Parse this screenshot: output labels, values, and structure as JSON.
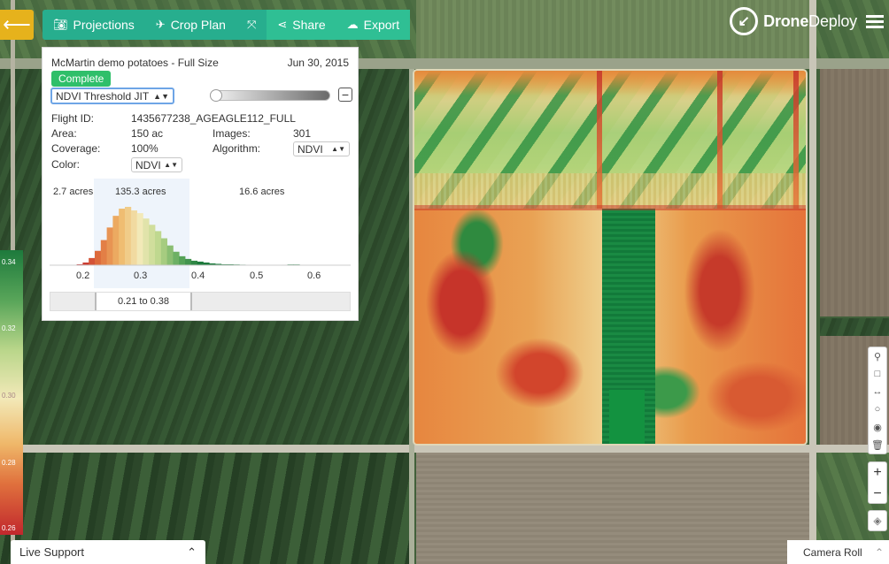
{
  "toolbar": {
    "back_icon": "arrow-left-icon",
    "projections": "Projections",
    "crop_plan": "Crop Plan",
    "share": "Share",
    "export": "Export"
  },
  "brand": {
    "name_bold": "Drone",
    "name_rest": "Deploy"
  },
  "panel": {
    "title": "McMartin demo potatoes - Full Size",
    "date": "Jun 30, 2015",
    "status": "Complete",
    "layer_select": "NDVI Threshold JIT",
    "flight_id_label": "Flight ID:",
    "flight_id": "1435677238_AGEAGLE112_FULL",
    "area_label": "Area:",
    "area": "150 ac",
    "images_label": "Images:",
    "images": "301",
    "coverage_label": "Coverage:",
    "coverage": "100%",
    "algorithm_label": "Algorithm:",
    "algorithm": "NDVI",
    "color_label": "Color:",
    "color": "NDVI",
    "range_text": "0.21 to 0.38"
  },
  "chart_data": {
    "type": "bar",
    "x_ticks": [
      "0.2",
      "0.3",
      "0.4",
      "0.5",
      "0.6"
    ],
    "xlim": [
      0.15,
      0.65
    ],
    "selection": [
      0.21,
      0.38
    ],
    "acres": [
      "2.7 acres",
      "135.3 acres",
      "16.6 acres"
    ],
    "bins": [
      0.2,
      0.21,
      0.22,
      0.23,
      0.24,
      0.25,
      0.26,
      0.27,
      0.28,
      0.29,
      0.3,
      0.31,
      0.32,
      0.33,
      0.34,
      0.35,
      0.36,
      0.37,
      0.38,
      0.39,
      0.4,
      0.41,
      0.42,
      0.43,
      0.44,
      0.45,
      0.46,
      0.47,
      0.48,
      0.49,
      0.5,
      0.51,
      0.52,
      0.53,
      0.54,
      0.55,
      0.56,
      0.57,
      0.58,
      0.59,
      0.6
    ],
    "counts": [
      1,
      3,
      8,
      16,
      28,
      42,
      55,
      63,
      65,
      61,
      58,
      52,
      45,
      38,
      30,
      22,
      15,
      10,
      7,
      5,
      4,
      3,
      2,
      1.5,
      1,
      1,
      0.8,
      0.6,
      0.5,
      0.4,
      0.3,
      0.3,
      0.3,
      0.3,
      0.5,
      0.8,
      0.8,
      0.4,
      0.3,
      0.2,
      0.2
    ]
  },
  "legend": [
    "0.34",
    "0.32",
    "0.30",
    "0.28",
    "0.26"
  ],
  "bottom": {
    "live_support": "Live Support",
    "camera_roll": "Camera Roll"
  }
}
